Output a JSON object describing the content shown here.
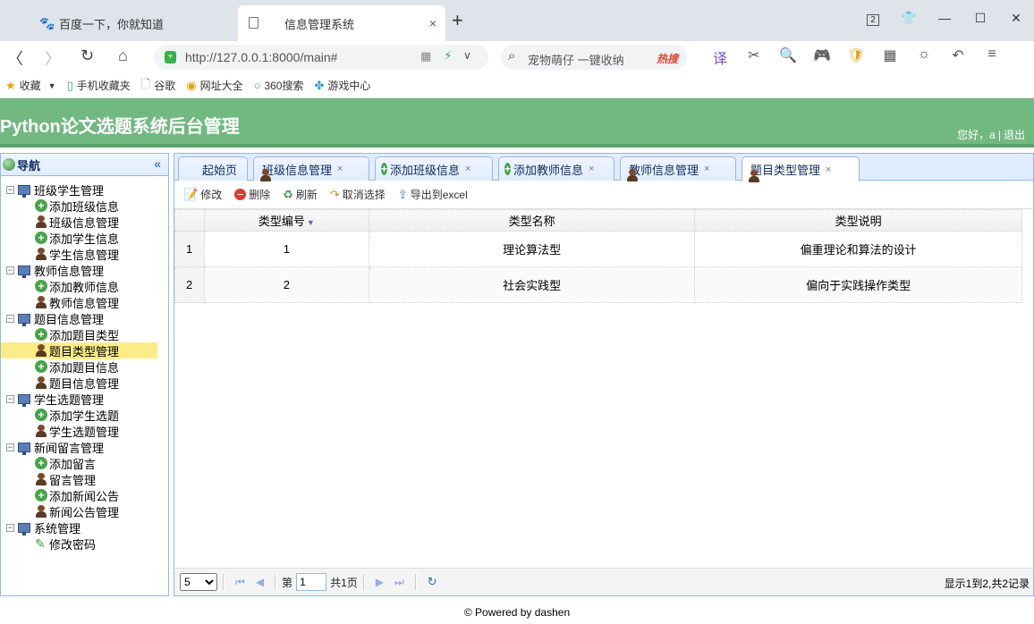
{
  "browser": {
    "tabs": [
      {
        "label": "百度一下，你就知道"
      },
      {
        "label": "信息管理系统",
        "close": "×"
      }
    ],
    "new_tab": "+",
    "window_badge": "2",
    "url": "http://127.0.0.1:8000/main#",
    "search_text": "宠物萌仔 一键收纳",
    "search_hot": "热搜",
    "bookmarks": [
      "收藏",
      "手机收藏夹",
      "谷歌",
      "网址大全",
      "360搜索",
      "游戏中心"
    ]
  },
  "app": {
    "title": "Python论文选题系统后台管理",
    "user_greeting": "您好，a",
    "logout": "退出"
  },
  "nav": {
    "title": "导航",
    "groups": [
      {
        "label": "班级学生管理",
        "items": [
          "添加班级信息",
          "班级信息管理",
          "添加学生信息",
          "学生信息管理"
        ]
      },
      {
        "label": "教师信息管理",
        "items": [
          "添加教师信息",
          "教师信息管理"
        ]
      },
      {
        "label": "题目信息管理",
        "items": [
          "添加题目类型",
          "题目类型管理",
          "添加题目信息",
          "题目信息管理"
        ]
      },
      {
        "label": "学生选题管理",
        "items": [
          "添加学生选题",
          "学生选题管理"
        ]
      },
      {
        "label": "新闻留言管理",
        "items": [
          "添加留言",
          "留言管理",
          "添加新闻公告",
          "新闻公告管理"
        ]
      },
      {
        "label": "系统管理",
        "items": [
          "修改密码"
        ]
      }
    ]
  },
  "tabs": [
    "起始页",
    "班级信息管理",
    "添加班级信息",
    "添加教师信息",
    "教师信息管理",
    "题目类型管理"
  ],
  "toolbar": {
    "edit": "修改",
    "delete": "删除",
    "refresh": "刷新",
    "cancel_select": "取消选择",
    "export": "导出到excel"
  },
  "grid": {
    "columns": [
      "类型编号",
      "类型名称",
      "类型说明"
    ],
    "rows": [
      {
        "rownum": "1",
        "id": "1",
        "name": "理论算法型",
        "desc": "偏重理论和算法的设计"
      },
      {
        "rownum": "2",
        "id": "2",
        "name": "社会实践型",
        "desc": "偏向于实践操作类型"
      }
    ]
  },
  "pager": {
    "page_size": "5",
    "page_prefix": "第",
    "page_value": "1",
    "page_total": "共1页",
    "info": "显示1到2,共2记录"
  },
  "footer": "© Powered by dashen"
}
